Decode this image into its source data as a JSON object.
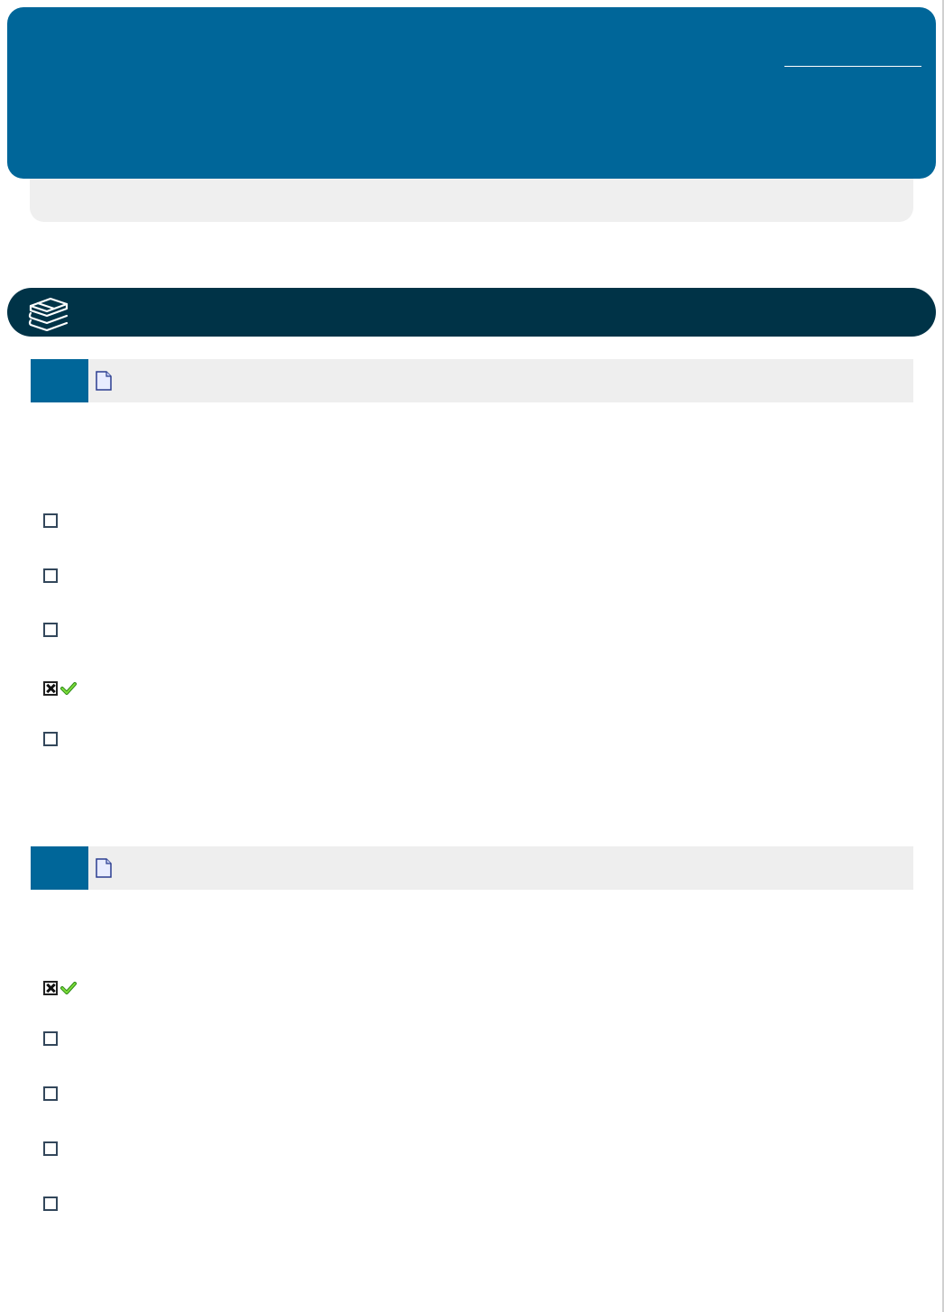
{
  "header": {
    "title": ""
  },
  "section": {
    "title": "",
    "icon": "books-icon"
  },
  "questions": [
    {
      "number": "",
      "text": "",
      "prompt": "",
      "icon": "document-icon",
      "options": [
        {
          "label": "",
          "checked": false,
          "correct": false
        },
        {
          "label": "",
          "checked": false,
          "correct": false
        },
        {
          "label": "",
          "checked": false,
          "correct": false
        },
        {
          "label": "",
          "checked": true,
          "correct": true
        },
        {
          "label": "",
          "checked": false,
          "correct": false
        }
      ]
    },
    {
      "number": "",
      "text": "",
      "prompt": "",
      "icon": "document-icon",
      "options": [
        {
          "label": "",
          "checked": true,
          "correct": true
        },
        {
          "label": "",
          "checked": false,
          "correct": false
        },
        {
          "label": "",
          "checked": false,
          "correct": false
        },
        {
          "label": "",
          "checked": false,
          "correct": false
        },
        {
          "label": "",
          "checked": false,
          "correct": false
        }
      ]
    }
  ],
  "colors": {
    "header": "#006699",
    "section_bar": "#003347",
    "question_header": "#eeeeee",
    "subheader": "#efefef",
    "check": "#66cc33"
  }
}
